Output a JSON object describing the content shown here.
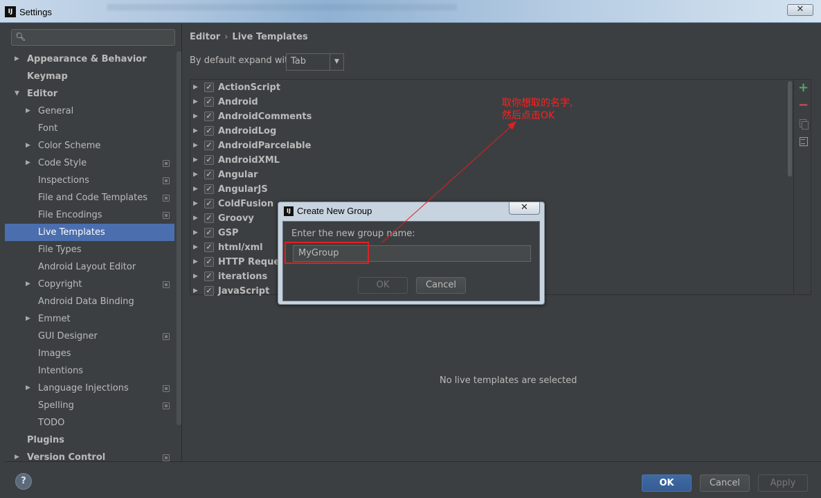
{
  "window": {
    "app_icon": "IJ",
    "title": "Settings",
    "close_glyph": "✕"
  },
  "sidebar": {
    "search_icon": "search-icon",
    "items": [
      {
        "label": "Appearance & Behavior",
        "level": 0,
        "arrow": "▶",
        "bold": true
      },
      {
        "label": "Keymap",
        "level": 0,
        "arrow": "",
        "bold": true
      },
      {
        "label": "Editor",
        "level": 0,
        "arrow": "▼",
        "bold": true
      },
      {
        "label": "General",
        "level": 1,
        "arrow": "▶"
      },
      {
        "label": "Font",
        "level": 1,
        "arrow": ""
      },
      {
        "label": "Color Scheme",
        "level": 1,
        "arrow": "▶"
      },
      {
        "label": "Code Style",
        "level": 1,
        "arrow": "▶",
        "project": true
      },
      {
        "label": "Inspections",
        "level": 1,
        "arrow": "",
        "project": true
      },
      {
        "label": "File and Code Templates",
        "level": 1,
        "arrow": "",
        "project": true
      },
      {
        "label": "File Encodings",
        "level": 1,
        "arrow": "",
        "project": true
      },
      {
        "label": "Live Templates",
        "level": 1,
        "arrow": "",
        "selected": true
      },
      {
        "label": "File Types",
        "level": 1,
        "arrow": ""
      },
      {
        "label": "Android Layout Editor",
        "level": 1,
        "arrow": ""
      },
      {
        "label": "Copyright",
        "level": 1,
        "arrow": "▶",
        "project": true
      },
      {
        "label": "Android Data Binding",
        "level": 1,
        "arrow": ""
      },
      {
        "label": "Emmet",
        "level": 1,
        "arrow": "▶"
      },
      {
        "label": "GUI Designer",
        "level": 1,
        "arrow": "",
        "project": true
      },
      {
        "label": "Images",
        "level": 1,
        "arrow": ""
      },
      {
        "label": "Intentions",
        "level": 1,
        "arrow": ""
      },
      {
        "label": "Language Injections",
        "level": 1,
        "arrow": "▶",
        "project": true
      },
      {
        "label": "Spelling",
        "level": 1,
        "arrow": "",
        "project": true
      },
      {
        "label": "TODO",
        "level": 1,
        "arrow": ""
      },
      {
        "label": "Plugins",
        "level": 0,
        "arrow": "",
        "bold": true
      },
      {
        "label": "Version Control",
        "level": 0,
        "arrow": "▶",
        "bold": true,
        "project": true
      }
    ]
  },
  "main": {
    "breadcrumb": {
      "first": "Editor",
      "separator": "›",
      "second": "Live Templates"
    },
    "expand_label": "By default expand with",
    "expand_value": "Tab",
    "combo_arrow": "▼",
    "templates": [
      "ActionScript",
      "Android",
      "AndroidComments",
      "AndroidLog",
      "AndroidParcelable",
      "AndroidXML",
      "Angular",
      "AngularJS",
      "ColdFusion",
      "Groovy",
      "GSP",
      "html/xml",
      "HTTP Request",
      "iterations",
      "JavaScript"
    ],
    "tree_arrow": "▶",
    "check_glyph": "✓",
    "toolbar": {
      "add": "+",
      "remove": "−"
    },
    "empty_message": "No live templates are selected"
  },
  "footer": {
    "help": "?",
    "ok": "OK",
    "cancel": "Cancel",
    "apply": "Apply"
  },
  "dialog": {
    "icon": "IJ",
    "title": "Create New Group",
    "close_glyph": "✕",
    "prompt": "Enter the new group name:",
    "input_value": "MyGroup",
    "ok": "OK",
    "cancel": "Cancel"
  },
  "annotation": {
    "line1": "取你想取的名字,",
    "line2": "然后点击OK",
    "color": "#ff2020"
  }
}
